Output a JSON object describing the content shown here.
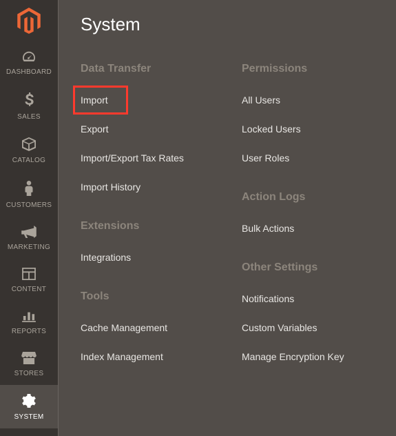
{
  "panel_title": "System",
  "sidebar": {
    "items": [
      {
        "label": "DASHBOARD",
        "name": "sidebar-item-dashboard"
      },
      {
        "label": "SALES",
        "name": "sidebar-item-sales"
      },
      {
        "label": "CATALOG",
        "name": "sidebar-item-catalog"
      },
      {
        "label": "CUSTOMERS",
        "name": "sidebar-item-customers"
      },
      {
        "label": "MARKETING",
        "name": "sidebar-item-marketing"
      },
      {
        "label": "CONTENT",
        "name": "sidebar-item-content"
      },
      {
        "label": "REPORTS",
        "name": "sidebar-item-reports"
      },
      {
        "label": "STORES",
        "name": "sidebar-item-stores"
      },
      {
        "label": "SYSTEM",
        "name": "sidebar-item-system"
      }
    ],
    "active": "SYSTEM"
  },
  "columns": [
    {
      "sections": [
        {
          "heading": "Data Transfer",
          "items": [
            {
              "label": "Import",
              "highlight": true
            },
            {
              "label": "Export"
            },
            {
              "label": "Import/Export Tax Rates"
            },
            {
              "label": "Import History"
            }
          ]
        },
        {
          "heading": "Extensions",
          "items": [
            {
              "label": "Integrations"
            }
          ]
        },
        {
          "heading": "Tools",
          "items": [
            {
              "label": "Cache Management"
            },
            {
              "label": "Index Management"
            }
          ]
        }
      ]
    },
    {
      "sections": [
        {
          "heading": "Permissions",
          "items": [
            {
              "label": "All Users"
            },
            {
              "label": "Locked Users"
            },
            {
              "label": "User Roles"
            }
          ]
        },
        {
          "heading": "Action Logs",
          "items": [
            {
              "label": "Bulk Actions"
            }
          ]
        },
        {
          "heading": "Other Settings",
          "items": [
            {
              "label": "Notifications"
            },
            {
              "label": "Custom Variables"
            },
            {
              "label": "Manage Encryption Key"
            }
          ]
        }
      ]
    }
  ]
}
